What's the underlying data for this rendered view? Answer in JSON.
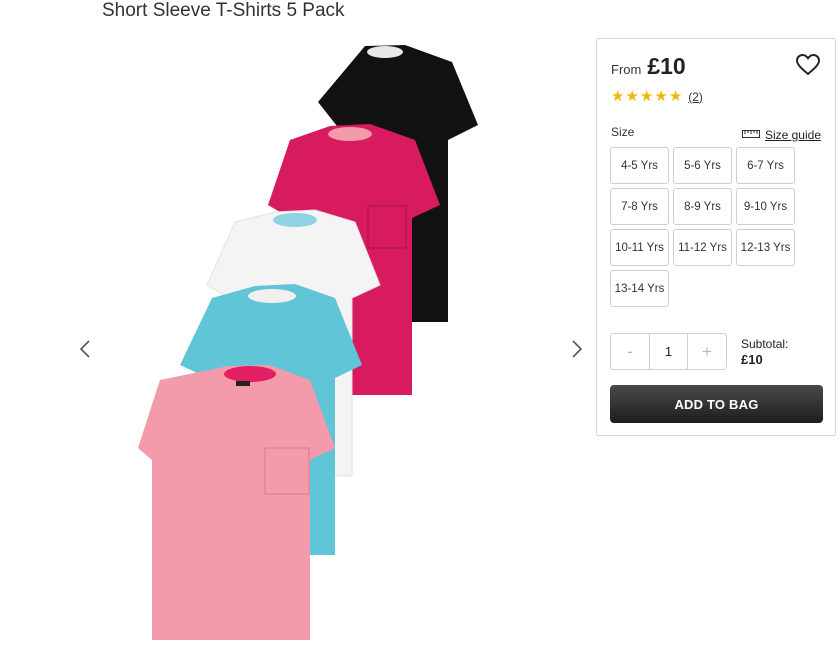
{
  "product": {
    "title": "Short Sleeve T-Shirts 5 Pack"
  },
  "gallery": {
    "shirt_colors": [
      "#111111",
      "#d81b60",
      "#f4f4f4",
      "#5fc5d7",
      "#f39aab"
    ]
  },
  "purchase": {
    "from_label": "From",
    "price": "£10",
    "rating_stars": 5,
    "review_count": "(2)",
    "size_label": "Size",
    "size_guide_label": "Size guide",
    "sizes": [
      "4-5 Yrs",
      "5-6 Yrs",
      "6-7 Yrs",
      "7-8 Yrs",
      "8-9 Yrs",
      "9-10 Yrs",
      "10-11 Yrs",
      "11-12 Yrs",
      "12-13 Yrs",
      "13-14 Yrs"
    ],
    "qty_minus": "-",
    "qty_value": "1",
    "qty_plus": "+",
    "subtotal_label": "Subtotal:",
    "subtotal_value": "£10",
    "add_to_bag_label": "ADD TO BAG"
  },
  "colors": {
    "star": "#f2b600",
    "button_dark": "#1d1d1d"
  }
}
